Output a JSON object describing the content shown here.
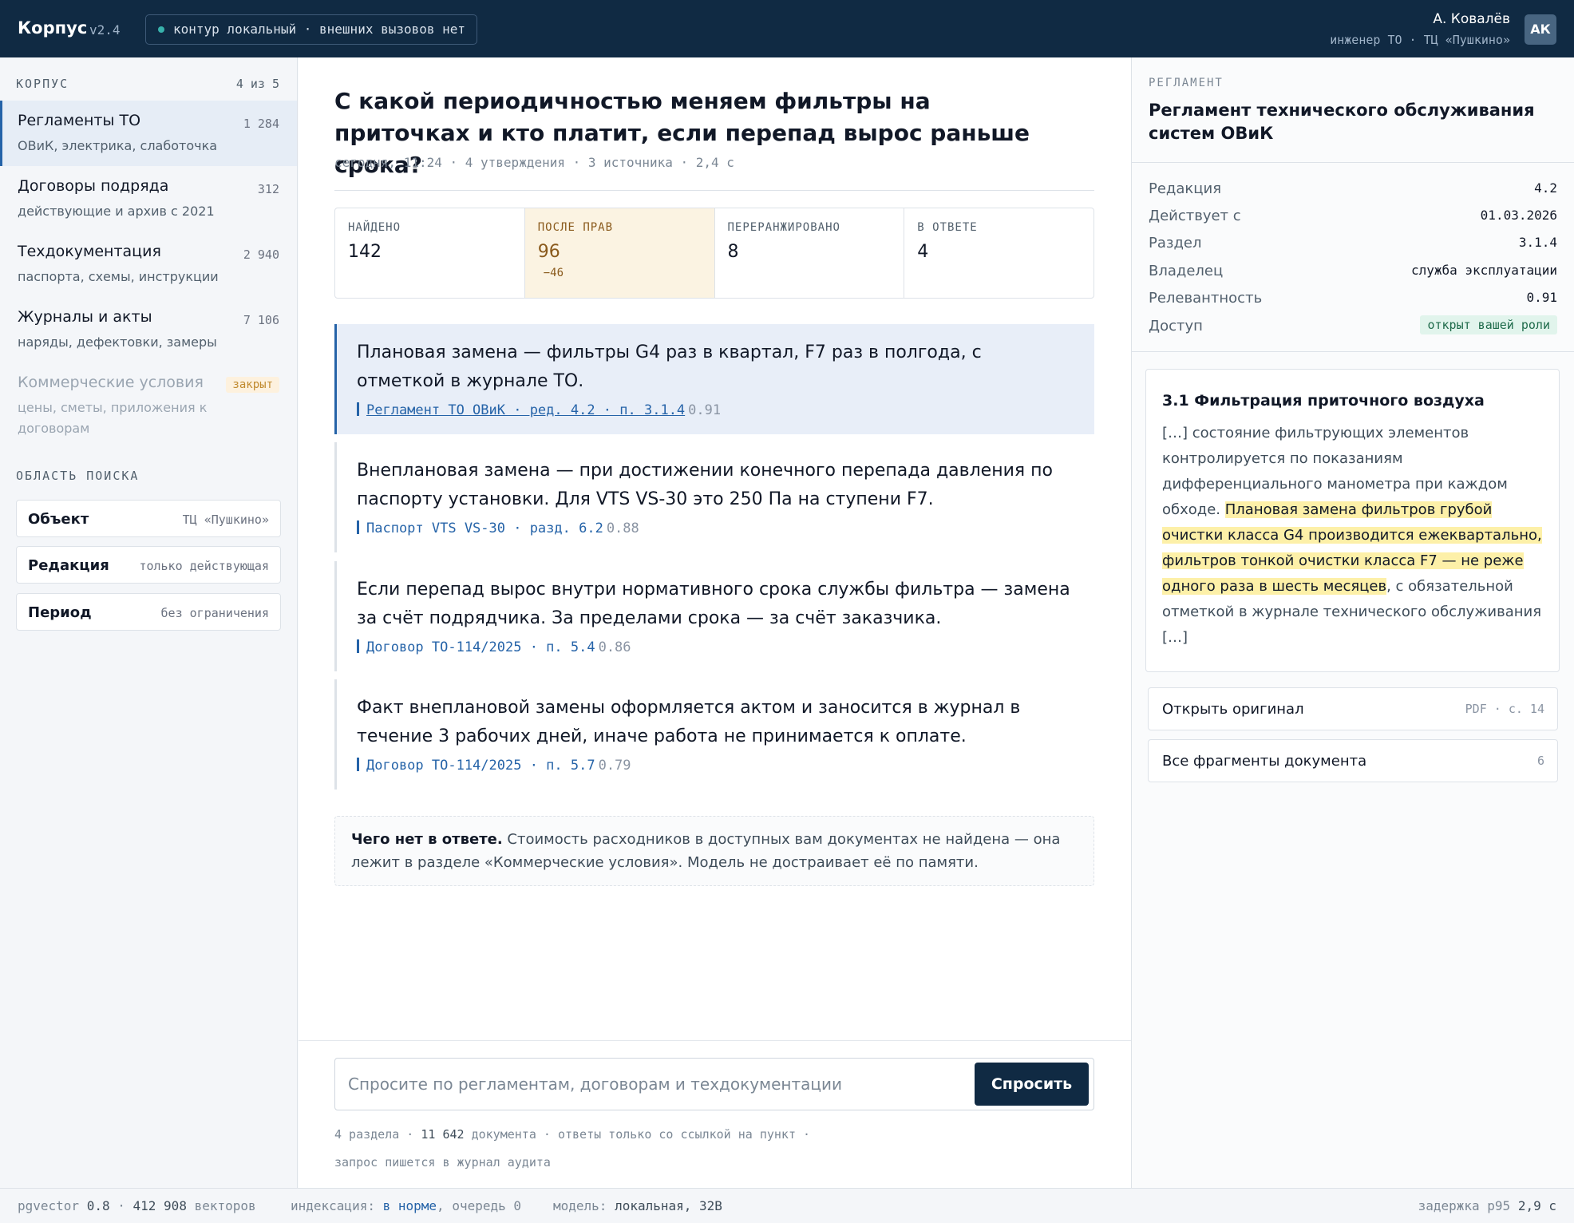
{
  "header": {
    "brand": "Корпус",
    "version": "v2.4",
    "contour": "контур локальный · внешних вызовов нет",
    "user_name": "А. Ковалёв",
    "user_role": "инженер ТО · ТЦ «Пушкино»",
    "avatar": "АК"
  },
  "sidebar": {
    "corpus_label": "КОРПУС",
    "corpus_count": "4 из 5",
    "corpora": [
      {
        "title": "Регламенты ТО",
        "count": "1 284",
        "sub": "ОВиК, электрика, слаботочка"
      },
      {
        "title": "Договоры подряда",
        "count": "312",
        "sub": "действующие и архив с 2021"
      },
      {
        "title": "Техдокументация",
        "count": "2 940",
        "sub": "паспорта, схемы, инструкции"
      },
      {
        "title": "Журналы и акты",
        "count": "7 106",
        "sub": "наряды, дефектовки, замеры"
      },
      {
        "title": "Коммерческие условия",
        "badge": "закрыт",
        "sub": "цены, сметы, приложения к договорам"
      }
    ],
    "scope_label": "ОБЛАСТЬ ПОИСКА",
    "scope": [
      {
        "label": "Объект",
        "value": "ТЦ «Пушкино»"
      },
      {
        "label": "Редакция",
        "value": "только действующая"
      },
      {
        "label": "Период",
        "value": "без ограничения"
      }
    ]
  },
  "main": {
    "question": "С какой периодичностью меняем фильтры на приточках и кто платит, если перепад вырос раньше срока?",
    "meta": "сегодня, 11:24 · 4 утверждения · 3 источника · 2,4 с",
    "stats": [
      {
        "label": "НАЙДЕНО",
        "value": "142"
      },
      {
        "label": "ПОСЛЕ ПРАВ",
        "value": "96",
        "delta": "−46"
      },
      {
        "label": "ПЕРЕРАНЖИРОВАНО",
        "value": "8"
      },
      {
        "label": "В ОТВЕТЕ",
        "value": "4"
      }
    ],
    "claims": [
      {
        "text": "Плановая замена — фильтры G4 раз в квартал, F7 раз в полгода, с отметкой в журнале ТО.",
        "source": "Регламент ТО ОВиК · ред. 4.2 · п. 3.1.4",
        "score": "0.91"
      },
      {
        "text": "Внеплановая замена — при достижении конечного перепада давления по паспорту установки. Для VTS VS-30 это 250 Па на ступени F7.",
        "source": "Паспорт VTS VS-30 · разд. 6.2",
        "score": "0.88"
      },
      {
        "text": "Если перепад вырос внутри нормативного срока службы фильтра — замена за счёт подрядчика. За пределами срока — за счёт заказчика.",
        "source": "Договор ТО-114/2025 · п. 5.4",
        "score": "0.86"
      },
      {
        "text": "Факт внеплановой замены оформляется актом и заносится в журнал в течение 3 рабочих дней, иначе работа не принимается к оплате.",
        "source": "Договор ТО-114/2025 · п. 5.7",
        "score": "0.79"
      }
    ],
    "missing_title": "Чего нет в ответе.",
    "missing_text": " Стоимость расходников в доступных вам документах не найдена — она лежит в разделе «Коммерческие условия». Модель не достраивает её по памяти.",
    "ask_placeholder": "Спросите по регламентам, договорам и техдокументации",
    "ask_button": "Спросить",
    "foot_sections": "4 раздела",
    "foot_docs_num": "11 642",
    "foot_docs": "документа",
    "foot_rule": "ответы только со ссылкой на пункт",
    "foot_audit": "запрос пишется в журнал аудита"
  },
  "panel": {
    "label": "РЕГЛАМЕНТ",
    "title": "Регламент технического обслуживания систем ОВиК",
    "props": [
      {
        "k": "Редакция",
        "v": "4.2"
      },
      {
        "k": "Действует с",
        "v": "01.03.2026"
      },
      {
        "k": "Раздел",
        "v": "3.1.4"
      },
      {
        "k": "Владелец",
        "v": "служба эксплуатации"
      },
      {
        "k": "Релевантность",
        "v": "0.91"
      }
    ],
    "access_k": "Доступ",
    "access_v": "открыт вашей роли",
    "excerpt_title": "3.1 Фильтрация приточного воздуха",
    "excerpt_before": "[…] состояние фильтрующих элементов контролируется по показаниям дифференциального манометра при каждом обходе. ",
    "excerpt_highlight": "Плановая замена фильтров грубой очистки класса G4 производится ежеквартально, фильтров тонкой очистки класса F7 — не реже одного раза в шесть месяцев",
    "excerpt_after": ", с обязательной отметкой в журнале технического обслуживания […]",
    "open_label": "Открыть оригинал",
    "open_meta": "PDF · с. 14",
    "all_label": "Все фрагменты документа",
    "all_meta": "6"
  },
  "status": {
    "pg_label": "pgvector",
    "pg_ver": "0.8",
    "vectors_num": "412 908",
    "vectors_label": "векторов",
    "index_label": "индексация:",
    "index_state": "в норме",
    "queue": ", очередь 0",
    "model_label": "модель:",
    "model_value": "локальная, 32B",
    "latency_label": "задержка p95",
    "latency_value": "2,9 с"
  }
}
